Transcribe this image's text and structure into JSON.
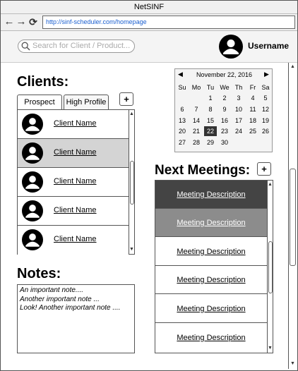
{
  "window": {
    "title": "NetSINF"
  },
  "browser": {
    "url": "http://sinf-scheduler.com/homepage",
    "back_icon": "arrow-left-icon",
    "forward_icon": "arrow-right-icon",
    "reload_icon": "reload-icon"
  },
  "header": {
    "search_placeholder": "Search for Client / Product...",
    "username": "Username"
  },
  "clients": {
    "title": "Clients:",
    "tabs": [
      {
        "label": "Prospect"
      },
      {
        "label": "High Profile"
      }
    ],
    "add_label": "+",
    "items": [
      {
        "name": "Client Name"
      },
      {
        "name": "Client Name"
      },
      {
        "name": "Client Name"
      },
      {
        "name": "Client Name"
      },
      {
        "name": "Client Name"
      }
    ]
  },
  "notes": {
    "title": "Notes:",
    "lines": [
      "An important note....",
      "Another important note ...",
      "Look! Another important note ...."
    ]
  },
  "calendar": {
    "month_label": "November 22, 2016",
    "weekdays": [
      "Su",
      "Mo",
      "Tu",
      "We",
      "Th",
      "Fr",
      "Sa"
    ],
    "weeks": [
      [
        "",
        "",
        "1",
        "2",
        "3",
        "4",
        "5"
      ],
      [
        "6",
        "7",
        "8",
        "9",
        "10",
        "11",
        "12"
      ],
      [
        "13",
        "14",
        "15",
        "16",
        "17",
        "18",
        "19"
      ],
      [
        "20",
        "21",
        "22",
        "23",
        "24",
        "25",
        "26"
      ],
      [
        "27",
        "28",
        "29",
        "30",
        "",
        "",
        ""
      ]
    ],
    "selected_day": "22"
  },
  "meetings": {
    "title": "Next Meetings:",
    "add_label": "+",
    "items": [
      {
        "description": "Meeting Description"
      },
      {
        "description": "Meeting Description"
      },
      {
        "description": "Meeting Description"
      },
      {
        "description": "Meeting Description"
      },
      {
        "description": "Meeting Description"
      },
      {
        "description": "Meeting Description"
      }
    ]
  }
}
